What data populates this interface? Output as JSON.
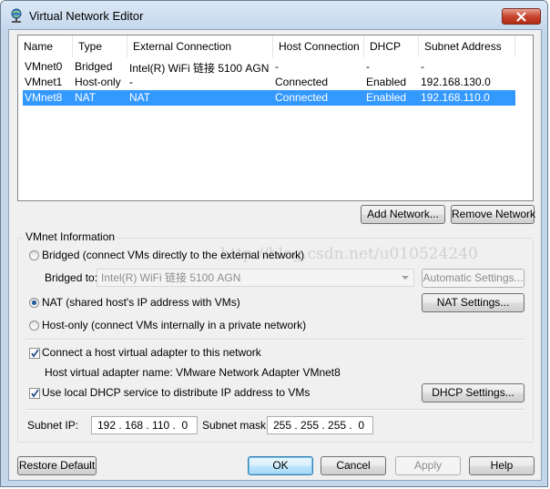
{
  "window": {
    "title": "Virtual Network Editor"
  },
  "table": {
    "columns": [
      "Name",
      "Type",
      "External Connection",
      "Host Connection",
      "DHCP",
      "Subnet Address"
    ],
    "rows": [
      {
        "name": "VMnet0",
        "type": "Bridged",
        "external": "Intel(R) WiFi 链接 5100 AGN",
        "host": "-",
        "dhcp": "-",
        "subnet": "-"
      },
      {
        "name": "VMnet1",
        "type": "Host-only",
        "external": "-",
        "host": "Connected",
        "dhcp": "Enabled",
        "subnet": "192.168.130.0"
      },
      {
        "name": "VMnet8",
        "type": "NAT",
        "external": "NAT",
        "host": "Connected",
        "dhcp": "Enabled",
        "subnet": "192.168.110.0"
      }
    ],
    "selected_row": "VMnet8"
  },
  "buttons": {
    "add_network": "Add Network...",
    "remove_network": "Remove Network",
    "automatic_settings": "Automatic Settings...",
    "nat_settings": "NAT Settings...",
    "dhcp_settings": "DHCP Settings...",
    "restore_default": "Restore Default",
    "ok": "OK",
    "cancel": "Cancel",
    "apply": "Apply",
    "help": "Help"
  },
  "vmnet_info": {
    "group_label": "VMnet Information",
    "bridged_label": "Bridged (connect VMs directly to the external network)",
    "bridged_to_label": "Bridged to:",
    "bridged_to_value": "Intel(R) WiFi 链接 5100 AGN",
    "nat_label": "NAT (shared host's IP address with VMs)",
    "hostonly_label": "Host-only (connect VMs internally in a private network)",
    "selected_mode": "NAT",
    "connect_adapter_label": "Connect a host virtual adapter to this network",
    "connect_adapter_checked": true,
    "adapter_name_label": "Host virtual adapter name: VMware Network Adapter VMnet8",
    "dhcp_label": "Use local DHCP service to distribute IP address to VMs",
    "dhcp_checked": true,
    "subnet_ip_label": "Subnet IP:",
    "subnet_ip_value": "192 . 168 . 110 .  0",
    "subnet_mask_label": "Subnet mask:",
    "subnet_mask_value": "255 . 255 . 255 .  0"
  },
  "watermark": "http://blog.csdn.net/u010524240",
  "icons": {
    "title": "network-globe-icon",
    "close": "close-icon",
    "dropdown": "chevron-down-icon",
    "check": "checkmark-icon"
  },
  "colors": {
    "selection": "#3399ff",
    "title_bg": "#c5d7ec",
    "close_button": "#c8452f"
  }
}
